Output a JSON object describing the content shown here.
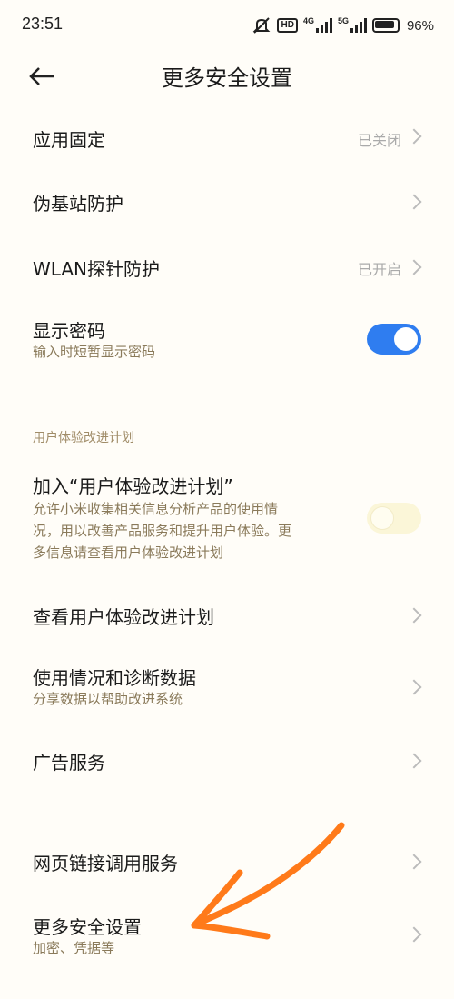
{
  "status_bar": {
    "time": "23:51",
    "hd": "HD",
    "net1": "4G",
    "net2": "5G",
    "battery": "96"
  },
  "header": {
    "title": "更多安全设置"
  },
  "items": {
    "app_pinning": {
      "title": "应用固定",
      "value": "已关闭"
    },
    "fake_base": {
      "title": "伪基站防护"
    },
    "wlan_probe": {
      "title": "WLAN探针防护",
      "value": "已开启"
    },
    "show_password": {
      "title": "显示密码",
      "subtitle": "输入时短暂显示密码",
      "enabled": true
    },
    "section_label": "用户体验改进计划",
    "join_program": {
      "title": "加入“用户体验改进计划”",
      "subtitle_1": "允许小米收集相关信息分析产品的使用情",
      "subtitle_2": "况，用以改善产品服务和提升用户体验。更",
      "subtitle_3": "多信息请查看用户体验改进计划",
      "enabled": false
    },
    "view_program": {
      "title": "查看用户体验改进计划"
    },
    "usage_diag": {
      "title": "使用情况和诊断数据",
      "subtitle": "分享数据以帮助改进系统"
    },
    "ad_service": {
      "title": "广告服务"
    },
    "web_link": {
      "title": "网页链接调用服务"
    },
    "more_security": {
      "title": "更多安全设置",
      "subtitle": "加密、凭据等"
    }
  },
  "colors": {
    "accent": "#2f7df0",
    "annotation": "#ff7a1a",
    "background": "#fffdf8"
  }
}
